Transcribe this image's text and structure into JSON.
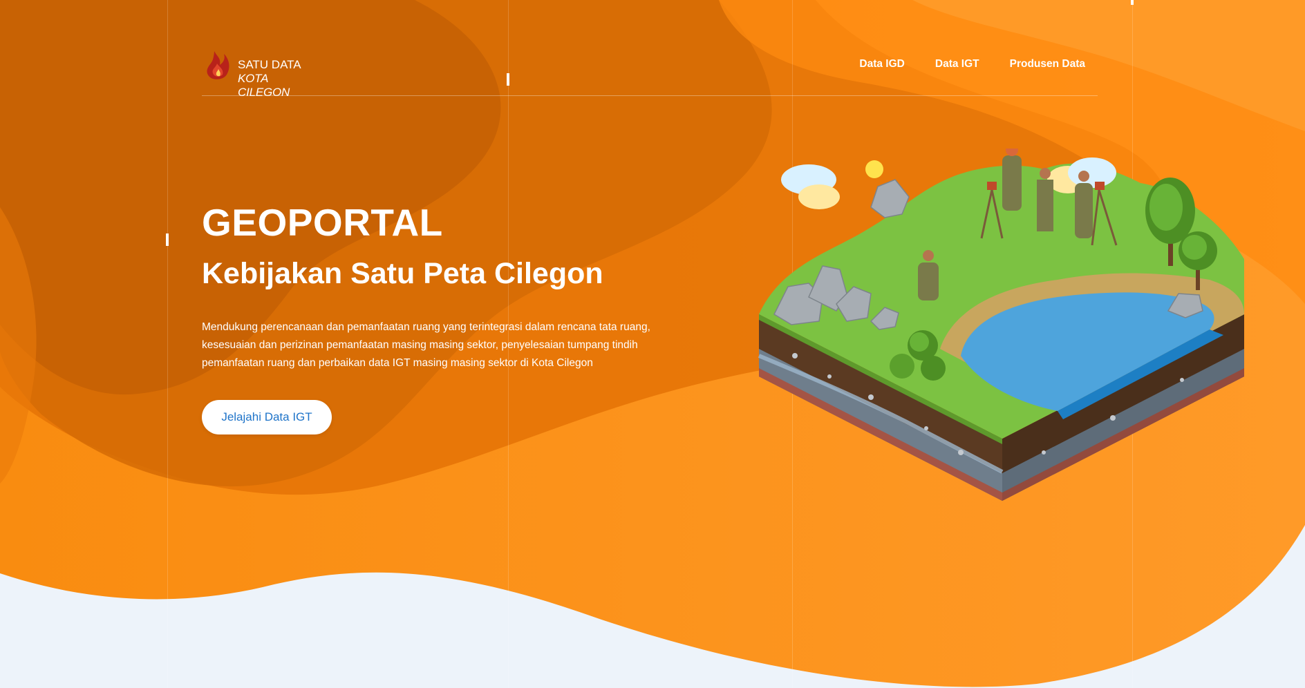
{
  "brand": {
    "line1": "SATU DATA",
    "line2": "KOTA CILEGON"
  },
  "nav": {
    "items": [
      {
        "label": "Data IGD"
      },
      {
        "label": "Data IGT"
      },
      {
        "label": "Produsen Data"
      }
    ]
  },
  "hero": {
    "title": "GEOPORTAL",
    "subtitle": "Kebijakan Satu Peta Cilegon",
    "description": "Mendukung perencanaan dan pemanfaatan ruang yang terintegrasi dalam rencana tata ruang, kesesuaian dan perizinan pemanfaatan masing masing sektor, penyelesaian tumpang tindih pemanfaatan ruang dan perbaikan data IGT masing masing sektor di Kota Cilegon",
    "cta_label": "Jelajahi Data IGT"
  },
  "illustration": {
    "icon": "isometric-surveyors-landscape"
  },
  "colors": {
    "primary_orange": "#f7850c",
    "dark_orange": "#c86606",
    "light_orange": "#ff9d2f",
    "page_bg": "#edf3fa",
    "cta_text": "#1f74c9"
  }
}
